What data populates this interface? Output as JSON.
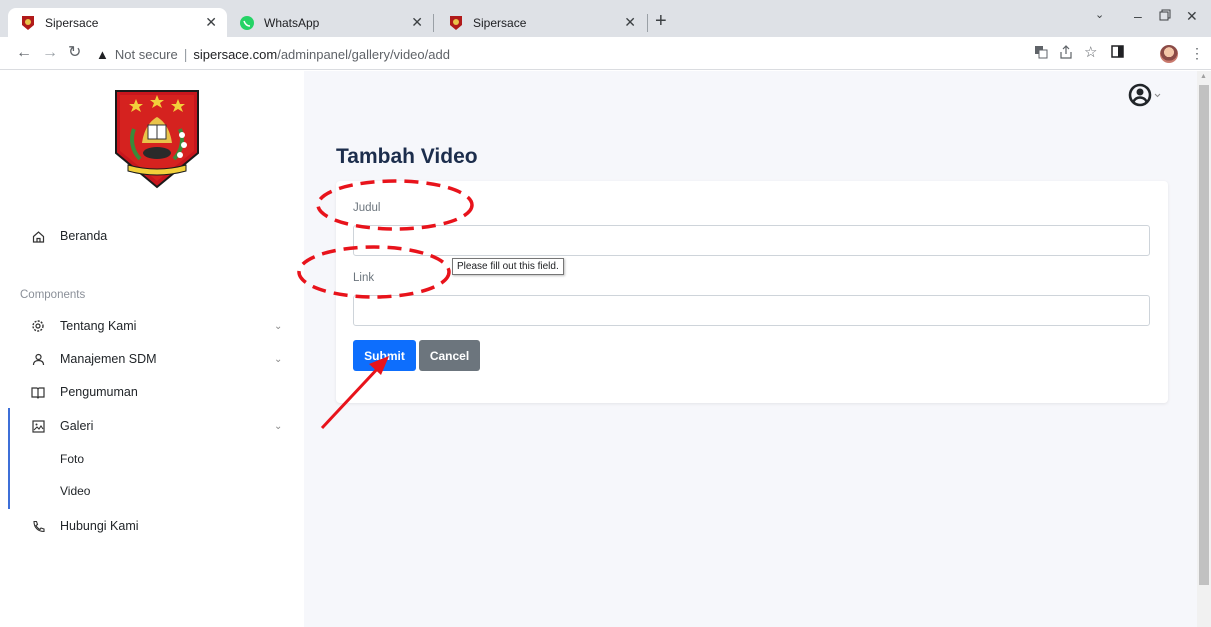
{
  "browser": {
    "tabs": [
      {
        "title": "Sipersace",
        "close": "✕"
      },
      {
        "title": "WhatsApp",
        "close": "✕"
      },
      {
        "title": "Sipersace",
        "close": "✕"
      }
    ],
    "new_tab": "+",
    "url": {
      "security_text": "Not secure",
      "host": "sipersace.com",
      "path": "/adminpanel/gallery/video/add"
    }
  },
  "sidebar": {
    "nav": [
      {
        "label": "Beranda",
        "icon": "home-icon"
      }
    ],
    "section_title": "Components",
    "components": [
      {
        "label": "Tentang Kami",
        "icon": "gear-icon",
        "expandable": true
      },
      {
        "label": "Manajemen SDM",
        "icon": "user-icon",
        "expandable": true
      },
      {
        "label": "Pengumuman",
        "icon": "book-icon",
        "expandable": false
      },
      {
        "label": "Galeri",
        "icon": "image-icon",
        "expandable": true,
        "active": true,
        "children": [
          {
            "label": "Foto"
          },
          {
            "label": "Video"
          }
        ]
      },
      {
        "label": "Hubungi Kami",
        "icon": "phone-icon",
        "expandable": false
      }
    ]
  },
  "main": {
    "title": "Tambah Video",
    "form": {
      "fields": [
        {
          "label": "Judul",
          "value": ""
        },
        {
          "label": "Link",
          "value": ""
        }
      ],
      "submit_label": "Submit",
      "cancel_label": "Cancel",
      "validation_tooltip": "Please fill out this field."
    }
  },
  "colors": {
    "primary": "#0d6efd",
    "secondary": "#6c757d",
    "title": "#1c2d4c",
    "annotation": "#e8131b",
    "sidebar_active": "#3d6fd8"
  }
}
